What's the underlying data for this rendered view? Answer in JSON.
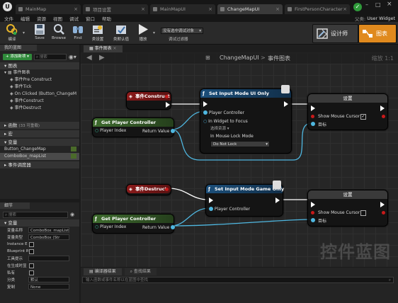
{
  "window": {
    "tabs": [
      "MainMap",
      "项目设置",
      "MainMapUI",
      "ChangeMapUI",
      "FirstPersonCharacter"
    ],
    "right_label": "User Widget",
    "right_prefix": "父类:"
  },
  "menu": [
    "文件",
    "编辑",
    "资源",
    "视图",
    "调试",
    "窗口",
    "帮助"
  ],
  "toolbar": {
    "compile": "编译",
    "save": "Save",
    "browse": "Browse",
    "find": "Find",
    "class_settings": "类设置",
    "class_defaults": "类默认值",
    "play": "播放",
    "debug_filter": "没有选中调试对象",
    "debug_filter_label": "调试过滤器",
    "designer": "设计师",
    "graph": "图表"
  },
  "my_blueprint": {
    "tab": "我的蓝图",
    "add_button": "+ 添加新项",
    "search_placeholder": "搜索",
    "graphs_header": "图表",
    "event_graph": "事件图表",
    "events": [
      "事件Pre Construct",
      "事件Tick",
      "On Clicked (Button_ChangeM",
      "事件Construct",
      "事件Destruct"
    ],
    "functions_header": "函数",
    "functions_count": "(33 可重载)",
    "macros_header": "宏",
    "variables_header": "变量",
    "variables": [
      "Button_ChangeMap",
      "ComboBox_mapList"
    ],
    "dispatchers_header": "事件调度器"
  },
  "details": {
    "tab": "细节",
    "search_placeholder": "搜索",
    "section": "变量",
    "rows": [
      {
        "label": "变量名称",
        "value": "ComboBox_mapList"
      },
      {
        "label": "变量类型",
        "value": "ComboBox (Str"
      },
      {
        "label": "Instance E",
        "value": ""
      },
      {
        "label": "Blueprint R",
        "value": ""
      },
      {
        "label": "工具提示",
        "value": ""
      },
      {
        "label": "在生成时显",
        "value": ""
      },
      {
        "label": "私有",
        "value": ""
      },
      {
        "label": "分类",
        "value": "默认"
      },
      {
        "label": "复制",
        "value": "None"
      }
    ]
  },
  "graph": {
    "tab": "事件图表",
    "breadcrumb_bp": "ChangeMapUI",
    "breadcrumb_sep": ">",
    "breadcrumb_graph": "事件图表",
    "zoom": "缩放 1:1",
    "watermark": "控件蓝图",
    "nodes": {
      "construct": "事件Construct",
      "destruct": "事件Destruct",
      "get_pc_1": "Get Player Controller",
      "get_pc_2": "Get Player Controller",
      "player_index": "Player Index",
      "player_index_val": "0",
      "return_value": "Return Value",
      "set_ui_only": "Set Input Mode UI Only",
      "set_game_only": "Set Input Mode Game Only",
      "player_controller": "Player Controller",
      "in_widget_to_focus": "In Widget to Focus",
      "select_asset": "选择资源 ▾",
      "in_mouse_lock_mode": "In Mouse Lock Mode",
      "mouse_lock_value": "Do Not Lock",
      "set_1": "设置",
      "set_2": "设置",
      "show_mouse_cursor": "Show Mouse Cursor",
      "target": "目标"
    }
  },
  "bottom": {
    "tabs": [
      "编译器结果",
      "查找结果"
    ],
    "search_placeholder": "输入函数或事件名称以在蓝图中查找"
  },
  "colors": {
    "event_header": "#8b1a1a",
    "pure_header": "#3e6b2e",
    "call_header": "#1c4f7a",
    "pin_blue": "#4fb7e0",
    "pin_red": "#c81a1a",
    "accent_orange": "#e08a1e"
  }
}
